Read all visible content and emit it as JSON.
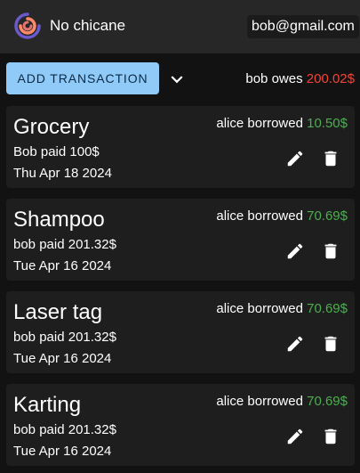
{
  "app": {
    "title": "No chicane",
    "logo_icon": "logo-swirl-icon",
    "user_email": "bob@gmail.com"
  },
  "toolbar": {
    "add_label": "ADD TRANSACTION",
    "expand_icon": "chevron-down-icon",
    "owes_prefix": "bob owes",
    "owes_amount": "200.02$",
    "owes_color": "#f44336"
  },
  "colors": {
    "accent": "#90caf9",
    "positive": "#4caf50",
    "negative": "#f44336",
    "surface": "#1e1e1e"
  },
  "transactions": [
    {
      "title": "Grocery",
      "paid": "Bob paid 100$",
      "date": "Thu Apr 18 2024",
      "borrowed_prefix": "alice borrowed",
      "borrowed_amount": "10.50$"
    },
    {
      "title": "Shampoo",
      "paid": "bob paid 201.32$",
      "date": "Tue Apr 16 2024",
      "borrowed_prefix": "alice borrowed",
      "borrowed_amount": "70.69$"
    },
    {
      "title": "Laser tag",
      "paid": "bob paid 201.32$",
      "date": "Tue Apr 16 2024",
      "borrowed_prefix": "alice borrowed",
      "borrowed_amount": "70.69$"
    },
    {
      "title": "Karting",
      "paid": "bob paid 201.32$",
      "date": "Tue Apr 16 2024",
      "borrowed_prefix": "alice borrowed",
      "borrowed_amount": "70.69$"
    }
  ]
}
